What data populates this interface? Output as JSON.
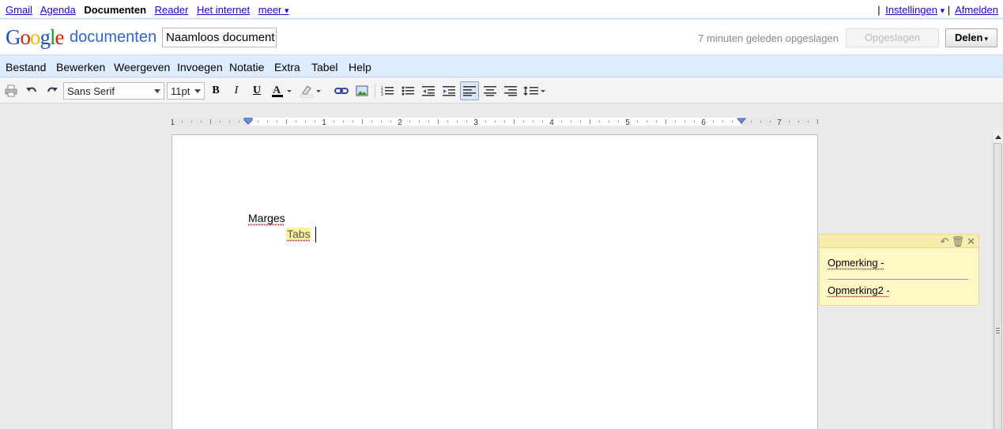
{
  "topnav": {
    "links": [
      "Gmail",
      "Agenda"
    ],
    "current": "Documenten",
    "links2": [
      "Reader",
      "Het internet"
    ],
    "more_label": "meer",
    "more_caret": "▾",
    "separator": "|",
    "settings_label": "Instellingen",
    "settings_caret": "▾",
    "signout_label": "Afmelden"
  },
  "header": {
    "logo_text": "Google",
    "product_name": "documenten",
    "doc_title": "Naamloos document",
    "save_status": "7 minuten geleden opgeslagen",
    "saved_button_label": "Opgeslagen",
    "share_button_label": "Delen"
  },
  "menu": {
    "items": [
      "Bestand",
      "Bewerken",
      "Weergeven",
      "Invoegen",
      "Notatie",
      "Extra",
      "Tabel",
      "Help"
    ]
  },
  "toolbar": {
    "font_family": "Sans Serif",
    "font_size": "11pt",
    "bold_label": "B",
    "italic_label": "I",
    "underline_label": "U",
    "text_color": "#000000",
    "active_alignment": "left"
  },
  "ruler": {
    "numbers": [
      "1",
      "1",
      "2",
      "3",
      "4",
      "5",
      "6",
      "7"
    ]
  },
  "document": {
    "line1": "Marges",
    "line2": "Tabs"
  },
  "comments": {
    "items": [
      "Opmerking -",
      "Opmerking2 -"
    ]
  },
  "colors": {
    "link": "#2200cc",
    "menubar_bg": "#e0ecff",
    "highlight": "#fff5a0",
    "comment_bg": "#fef8c7"
  }
}
